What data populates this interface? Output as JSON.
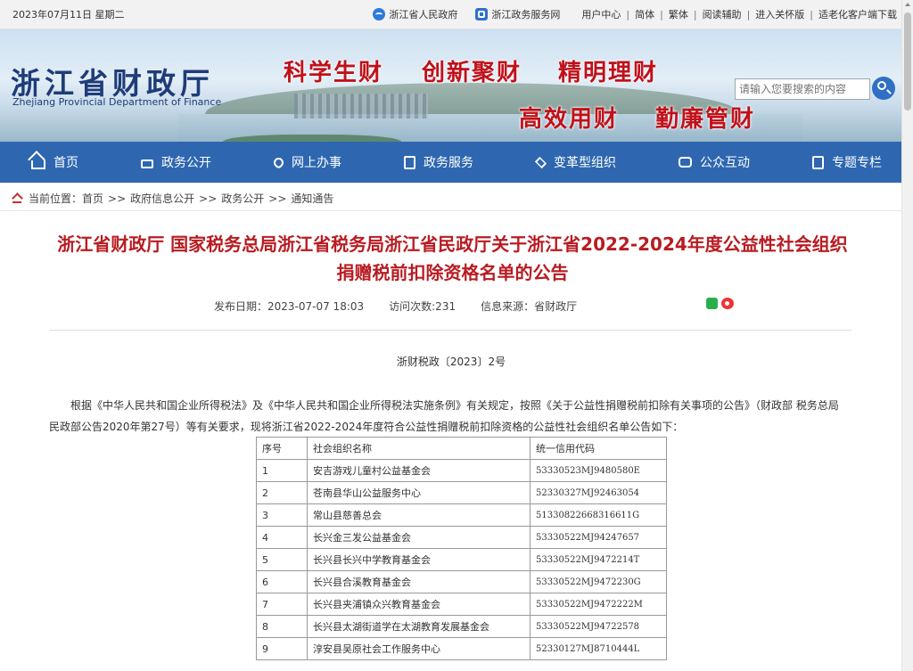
{
  "topbar": {
    "date": "2023年07月11日 星期二",
    "links": {
      "zj_gov": "浙江省人民政府",
      "zj_service": "浙江政务服务网",
      "user_center": "用户中心",
      "simplified": "简体",
      "traditional": "繁体",
      "reading_aid": "阅读辅助",
      "care_version": "进入关怀版",
      "elder_client": "适老化客户端下载"
    }
  },
  "header": {
    "logo_cn": "浙江省财政厅",
    "logo_en": "Zhejiang Provincial Department of Finance",
    "slogans": [
      "科学生财",
      "创新聚财",
      "精明理财",
      "高效用财",
      "勤廉管财"
    ],
    "search_placeholder": "请输入您要搜索的内容"
  },
  "nav": {
    "items": [
      {
        "label": "首页",
        "icon": "home-icon"
      },
      {
        "label": "政务公开",
        "icon": "folder-icon"
      },
      {
        "label": "网上办事",
        "icon": "heart-hand-icon"
      },
      {
        "label": "政务服务",
        "icon": "document-icon"
      },
      {
        "label": "变革型组织",
        "icon": "layers-icon"
      },
      {
        "label": "公众互动",
        "icon": "chat-icon"
      },
      {
        "label": "专题专栏",
        "icon": "list-icon"
      }
    ]
  },
  "breadcrumb": {
    "prefix": "当前位置：",
    "items": [
      "首页",
      "政府信息公开",
      "政务公开",
      "通知通告"
    ],
    "separator": ">>"
  },
  "article": {
    "title": "浙江省财政厅 国家税务总局浙江省税务局浙江省民政厅关于浙江省2022-2024年度公益性社会组织捐赠税前扣除资格名单的公告",
    "publish_date": "发布日期：2023-07-07 18:03",
    "views": "访问次数:231",
    "source": "信息来源：省财政厅",
    "doc_number": "浙财税政〔2023〕2号",
    "paragraph": "根据《中华人民共和国企业所得税法》及《中华人民共和国企业所得税法实施条例》有关规定，按照《关于公益性捐赠税前扣除有关事项的公告》（财政部 税务总局 民政部公告2020年第27号）等有关要求，现将浙江省2022-2024年度符合公益性捐赠税前扣除资格的公益性社会组织名单公告如下："
  },
  "table": {
    "headers": [
      "序号",
      "社会组织名称",
      "统一信用代码"
    ],
    "rows": [
      [
        "1",
        "安吉游戏儿童村公益基金会",
        "53330523MJ9480580E"
      ],
      [
        "2",
        "苍南县华山公益服务中心",
        "52330327MJ92463054"
      ],
      [
        "3",
        "常山县慈善总会",
        "51330822668316611G"
      ],
      [
        "4",
        "长兴金三发公益基金会",
        "53330522MJ94247657"
      ],
      [
        "5",
        "长兴县长兴中学教育基金会",
        "53330522MJ9472214T"
      ],
      [
        "6",
        "长兴县合溪教育基金会",
        "53330522MJ9472230G"
      ],
      [
        "7",
        "长兴县夹浦镇众兴教育基金会",
        "53330522MJ9472222M"
      ],
      [
        "8",
        "长兴县太湖街道学在太湖教育发展基金会",
        "53330522MJ94722578"
      ],
      [
        "9",
        "淳安县吴原社会工作服务中心",
        "52330127MJ8710444L"
      ]
    ]
  }
}
